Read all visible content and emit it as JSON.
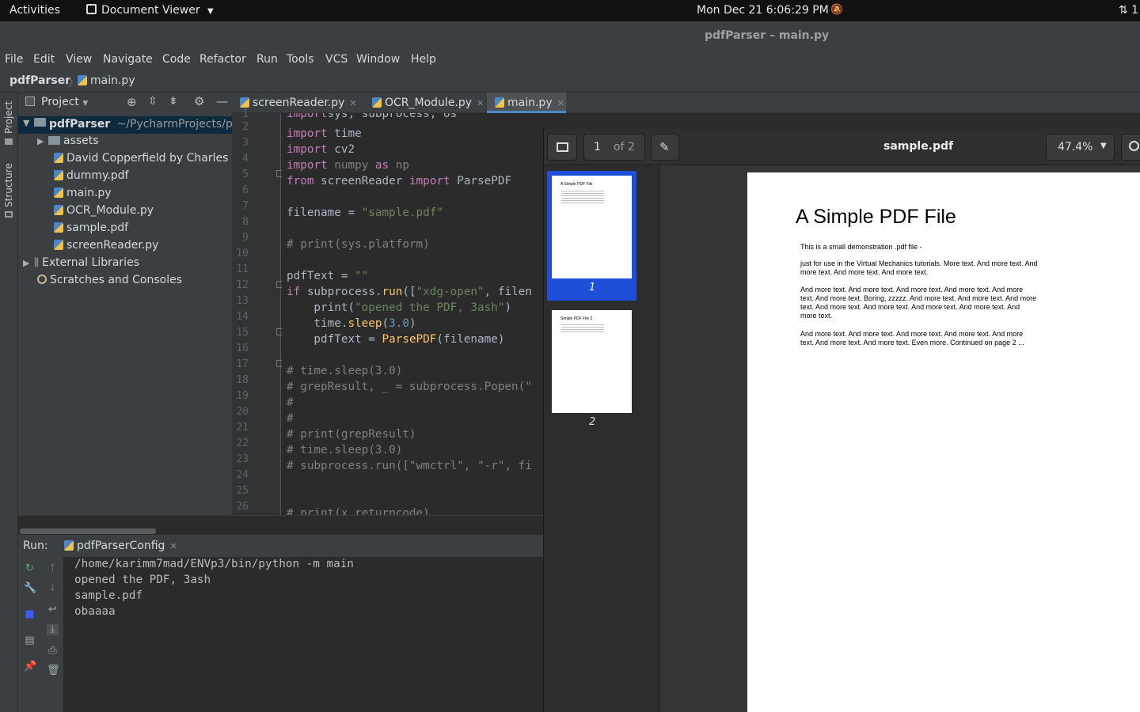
{
  "topbar": {
    "activities": "Activities",
    "app_menu": "Document Viewer",
    "clock": "Mon Dec 21  6:06:29 PM",
    "tray": "⇅ 1"
  },
  "window_title": "pdfParser – main.py",
  "menu": [
    "File",
    "Edit",
    "View",
    "Navigate",
    "Code",
    "Refactor",
    "Run",
    "Tools",
    "VCS",
    "Window",
    "Help"
  ],
  "breadcrumb": {
    "project": "pdfParser",
    "file": "main.py"
  },
  "side_labels": {
    "project": "Project",
    "structure": "Structure"
  },
  "project_panel": {
    "title": "Project",
    "root": "pdfParser",
    "root_path": "~/PycharmProjects/pd",
    "items": [
      "assets",
      "David Copperfield by Charles D",
      "dummy.pdf",
      "main.py",
      "OCR_Module.py",
      "sample.pdf",
      "screenReader.py"
    ],
    "external": "External Libraries",
    "scratches": "Scratches and Consoles"
  },
  "tabs": [
    {
      "label": "screenReader.py"
    },
    {
      "label": "OCR_Module.py"
    },
    {
      "label": "main.py"
    }
  ],
  "editor": {
    "line_numbers": [
      "1",
      "2",
      "3",
      "4",
      "5",
      "6",
      "7",
      "8",
      "9",
      "10",
      "11",
      "12",
      "13",
      "14",
      "15",
      "16",
      "17",
      "18",
      "19",
      "20",
      "21",
      "22",
      "23",
      "24",
      "25",
      "26"
    ]
  },
  "run": {
    "label": "Run:",
    "config": "pdfParserConfig",
    "output": [
      "/home/karimm7mad/ENVp3/bin/python -m main",
      "opened the PDF, 3ash",
      "sample.pdf",
      "obaaaa"
    ]
  },
  "viewer": {
    "page_current": "1",
    "page_total": "of 2",
    "doc_title": "sample.pdf",
    "zoom": "47.4%",
    "thumb_labels": [
      "1",
      "2"
    ],
    "thumb1_title": "A Simple PDF File",
    "thumb2_title": "Simple PDF File 2",
    "page": {
      "title": "A Simple PDF File",
      "paragraphs": [
        "This is a small demonstration .pdf file -",
        "just for use in the Virtual Mechanics tutorials. More text. And more text. And more text. And more text. And more text.",
        "And more text. And more text. And more text. And more text. And more text. And more text. Boring, zzzzz. And more text. And more text. And more text. And more text. And more text. And more text. And more text. And more text.",
        "And more text. And more text. And more text. And more text. And more text. And more text. And more text. Even more. Continued on page 2 ..."
      ]
    }
  },
  "colors": {
    "accent": "#4a88c7",
    "selection": "#1d4fd8"
  }
}
